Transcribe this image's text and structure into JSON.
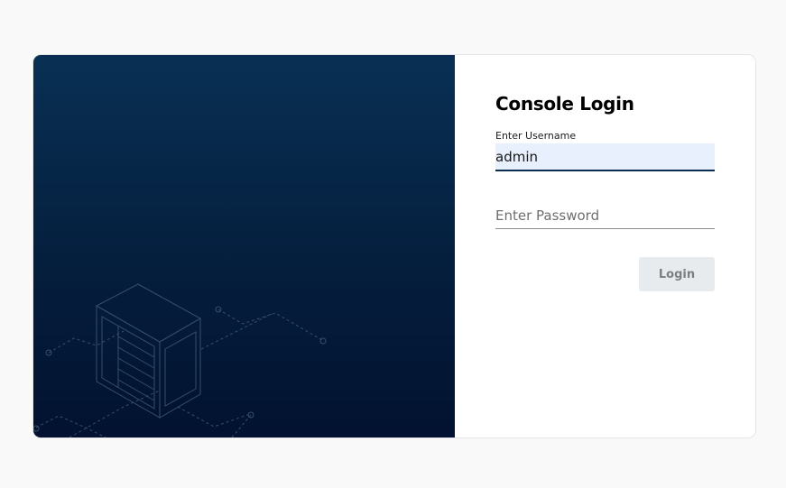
{
  "login": {
    "title": "Console Login",
    "username_label": "Enter Username",
    "username_value": "admin",
    "password_placeholder": "Enter Password",
    "login_button_label": "Login"
  },
  "colors": {
    "hero_gradient_top": "#093054",
    "hero_gradient_bottom": "#021230",
    "input_autofill_bg": "#e8f0fe",
    "input_underline": "#0a2d4f",
    "button_bg": "#e8ebed",
    "button_text": "#7b7f82",
    "page_bg": "#f9f9f9"
  },
  "icons": {
    "hero_illustration": "server-rack-circuit-illustration"
  }
}
